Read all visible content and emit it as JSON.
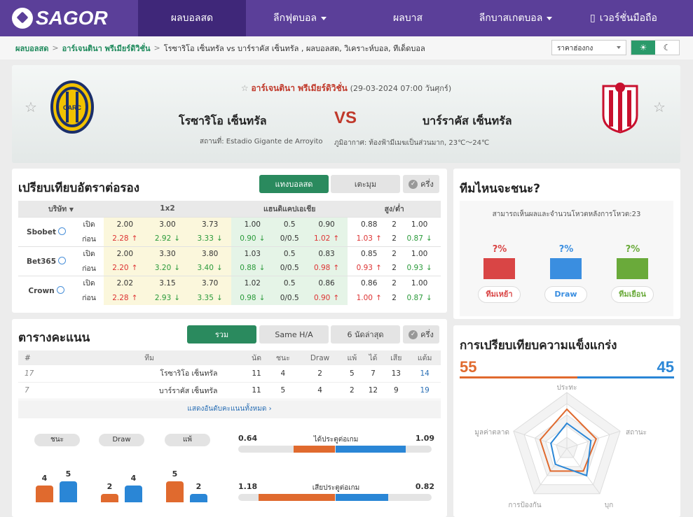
{
  "nav": {
    "logo": "SAGOR",
    "items": [
      {
        "label": "ผลบอลสด",
        "active": true,
        "caret": false
      },
      {
        "label": "ลีกฟุตบอล",
        "active": false,
        "caret": true
      },
      {
        "label": "ผลบาส",
        "active": false,
        "caret": false
      },
      {
        "label": "ลีกบาสเกตบอล",
        "active": false,
        "caret": true
      },
      {
        "label": "เวอร์ชั่นมือถือ",
        "active": false,
        "caret": false
      }
    ]
  },
  "breadcrumb": {
    "home": "ผลบอลสด",
    "league": "อาร์เจนตินา พรีเมียร์ดิวิชั่น",
    "current": "โรซาริโอ เซ็นทรัล vs บาร์ราคัส เซ็นทรัล , ผลบอลสด, วิเคราะห์บอล, ทีเด็ดบอล"
  },
  "odds_select": "ราคาฮ่องกง",
  "match": {
    "league": "อาร์เจนตินา พรีเมียร์ดิวิชั่น",
    "datetime": "(29-03-2024 07:00 วันศุกร์)",
    "home": "โรซาริโอ เซ็นทรัล",
    "away": "บาร์ราคัส เซ็นทรัล",
    "vs": "VS",
    "venue": "สถานที่: Estadio Gigante de Arroyito",
    "weather": "ภูมิอากาศ: ท้องฟ้ามีเมฆเป็นส่วนมาก, 23℃～24℃"
  },
  "odds_panel": {
    "title": "เปรียบเทียบอัตราต่อรอง",
    "tabs": [
      "แทงบอลสด",
      "เตะมุม"
    ],
    "toggle": "ครึ่ง",
    "headers": {
      "company": "บริษัท",
      "x12": "1x2",
      "ah": "แฮนดิแคปเอเชีย",
      "ou": "สูง/ต่ำ"
    },
    "rows": [
      {
        "company": "Sbobet",
        "open_label": "เปิด",
        "close_label": "ก่อน",
        "open": [
          "2.00",
          "3.00",
          "3.73",
          "1.00",
          "0.5",
          "0.90",
          "0.88",
          "2",
          "1.00"
        ],
        "close": [
          "2.28",
          "2.92",
          "3.33",
          "0.90",
          "0/0.5",
          "1.02",
          "1.03",
          "2",
          "0.87"
        ],
        "dir": [
          "up",
          "dn",
          "dn",
          "dn",
          "",
          "up",
          "up",
          "",
          "dn"
        ]
      },
      {
        "company": "Bet365",
        "open_label": "เปิด",
        "close_label": "ก่อน",
        "open": [
          "2.00",
          "3.30",
          "3.80",
          "1.03",
          "0.5",
          "0.83",
          "0.85",
          "2",
          "1.00"
        ],
        "close": [
          "2.20",
          "3.20",
          "3.40",
          "0.88",
          "0/0.5",
          "0.98",
          "0.93",
          "2",
          "0.93"
        ],
        "dir": [
          "up",
          "dn",
          "dn",
          "dn",
          "",
          "up",
          "up",
          "",
          "dn"
        ]
      },
      {
        "company": "Crown",
        "open_label": "เปิด",
        "close_label": "ก่อน",
        "open": [
          "2.02",
          "3.15",
          "3.70",
          "1.02",
          "0.5",
          "0.86",
          "0.86",
          "2",
          "1.00"
        ],
        "close": [
          "2.28",
          "2.93",
          "3.35",
          "0.98",
          "0/0.5",
          "0.90",
          "1.00",
          "2",
          "0.87"
        ],
        "dir": [
          "up",
          "dn",
          "dn",
          "dn",
          "",
          "up",
          "up",
          "",
          "dn"
        ]
      }
    ]
  },
  "standings": {
    "title": "ตารางคะแนน",
    "tabs": [
      "รวม",
      "Same H/A",
      "6 นัดล่าสุด"
    ],
    "toggle": "ครึ่ง",
    "headers": [
      "#",
      "ทีม",
      "นัด",
      "ชนะ",
      "Draw",
      "แพ้",
      "ได้",
      "เสีย",
      "แต้ม"
    ],
    "rows": [
      [
        "17",
        "โรซาริโอ เซ็นทรัล",
        "11",
        "4",
        "2",
        "5",
        "7",
        "13",
        "14"
      ],
      [
        "7",
        "บาร์ราคัส เซ็นทรัล",
        "11",
        "5",
        "4",
        "2",
        "12",
        "9",
        "19"
      ]
    ],
    "show_all": "แสดงอันดับคะแนนทั้งหมด",
    "pills": [
      "ชนะ",
      "Draw",
      "แพ้"
    ],
    "bars": [
      {
        "home": 4,
        "away": 5
      },
      {
        "home": 2,
        "away": 4
      },
      {
        "home": 5,
        "away": 2
      }
    ],
    "stats": [
      {
        "label": "ได้ประตูต่อเกม",
        "home": "0.64",
        "away": "1.09",
        "home_v": 0.64,
        "away_v": 1.09
      },
      {
        "label": "เสียประตูต่อเกม",
        "home": "1.18",
        "away": "0.82",
        "home_v": 1.18,
        "away_v": 0.82
      }
    ]
  },
  "vote": {
    "title": "ทีมไหนจะชนะ?",
    "note": "สามารถเห็นผลและจำนวนโหวตหลังการโหวต:23",
    "options": [
      {
        "pct": "?%",
        "label": "ทีมเหย้า",
        "color": "#d94545"
      },
      {
        "pct": "?%",
        "label": "Draw",
        "color": "#3a8ee0"
      },
      {
        "pct": "?%",
        "label": "ทีมเยือน",
        "color": "#6aaa3a"
      }
    ]
  },
  "strength": {
    "title": "การเปรียบเทียบความแข็งแกร่ง",
    "home": "55",
    "away": "45",
    "home_v": 55,
    "away_v": 45,
    "axes": [
      "ประทะ",
      "สถานะ",
      "บุก",
      "การป้องกัน",
      "มูลค่าตลาด"
    ],
    "home_vals": [
      0.7,
      0.55,
      0.5,
      0.5,
      0.5
    ],
    "away_vals": [
      0.45,
      0.45,
      0.6,
      0.35,
      0.3
    ],
    "home_color": "#e06a2e",
    "away_color": "#2a86d6"
  }
}
